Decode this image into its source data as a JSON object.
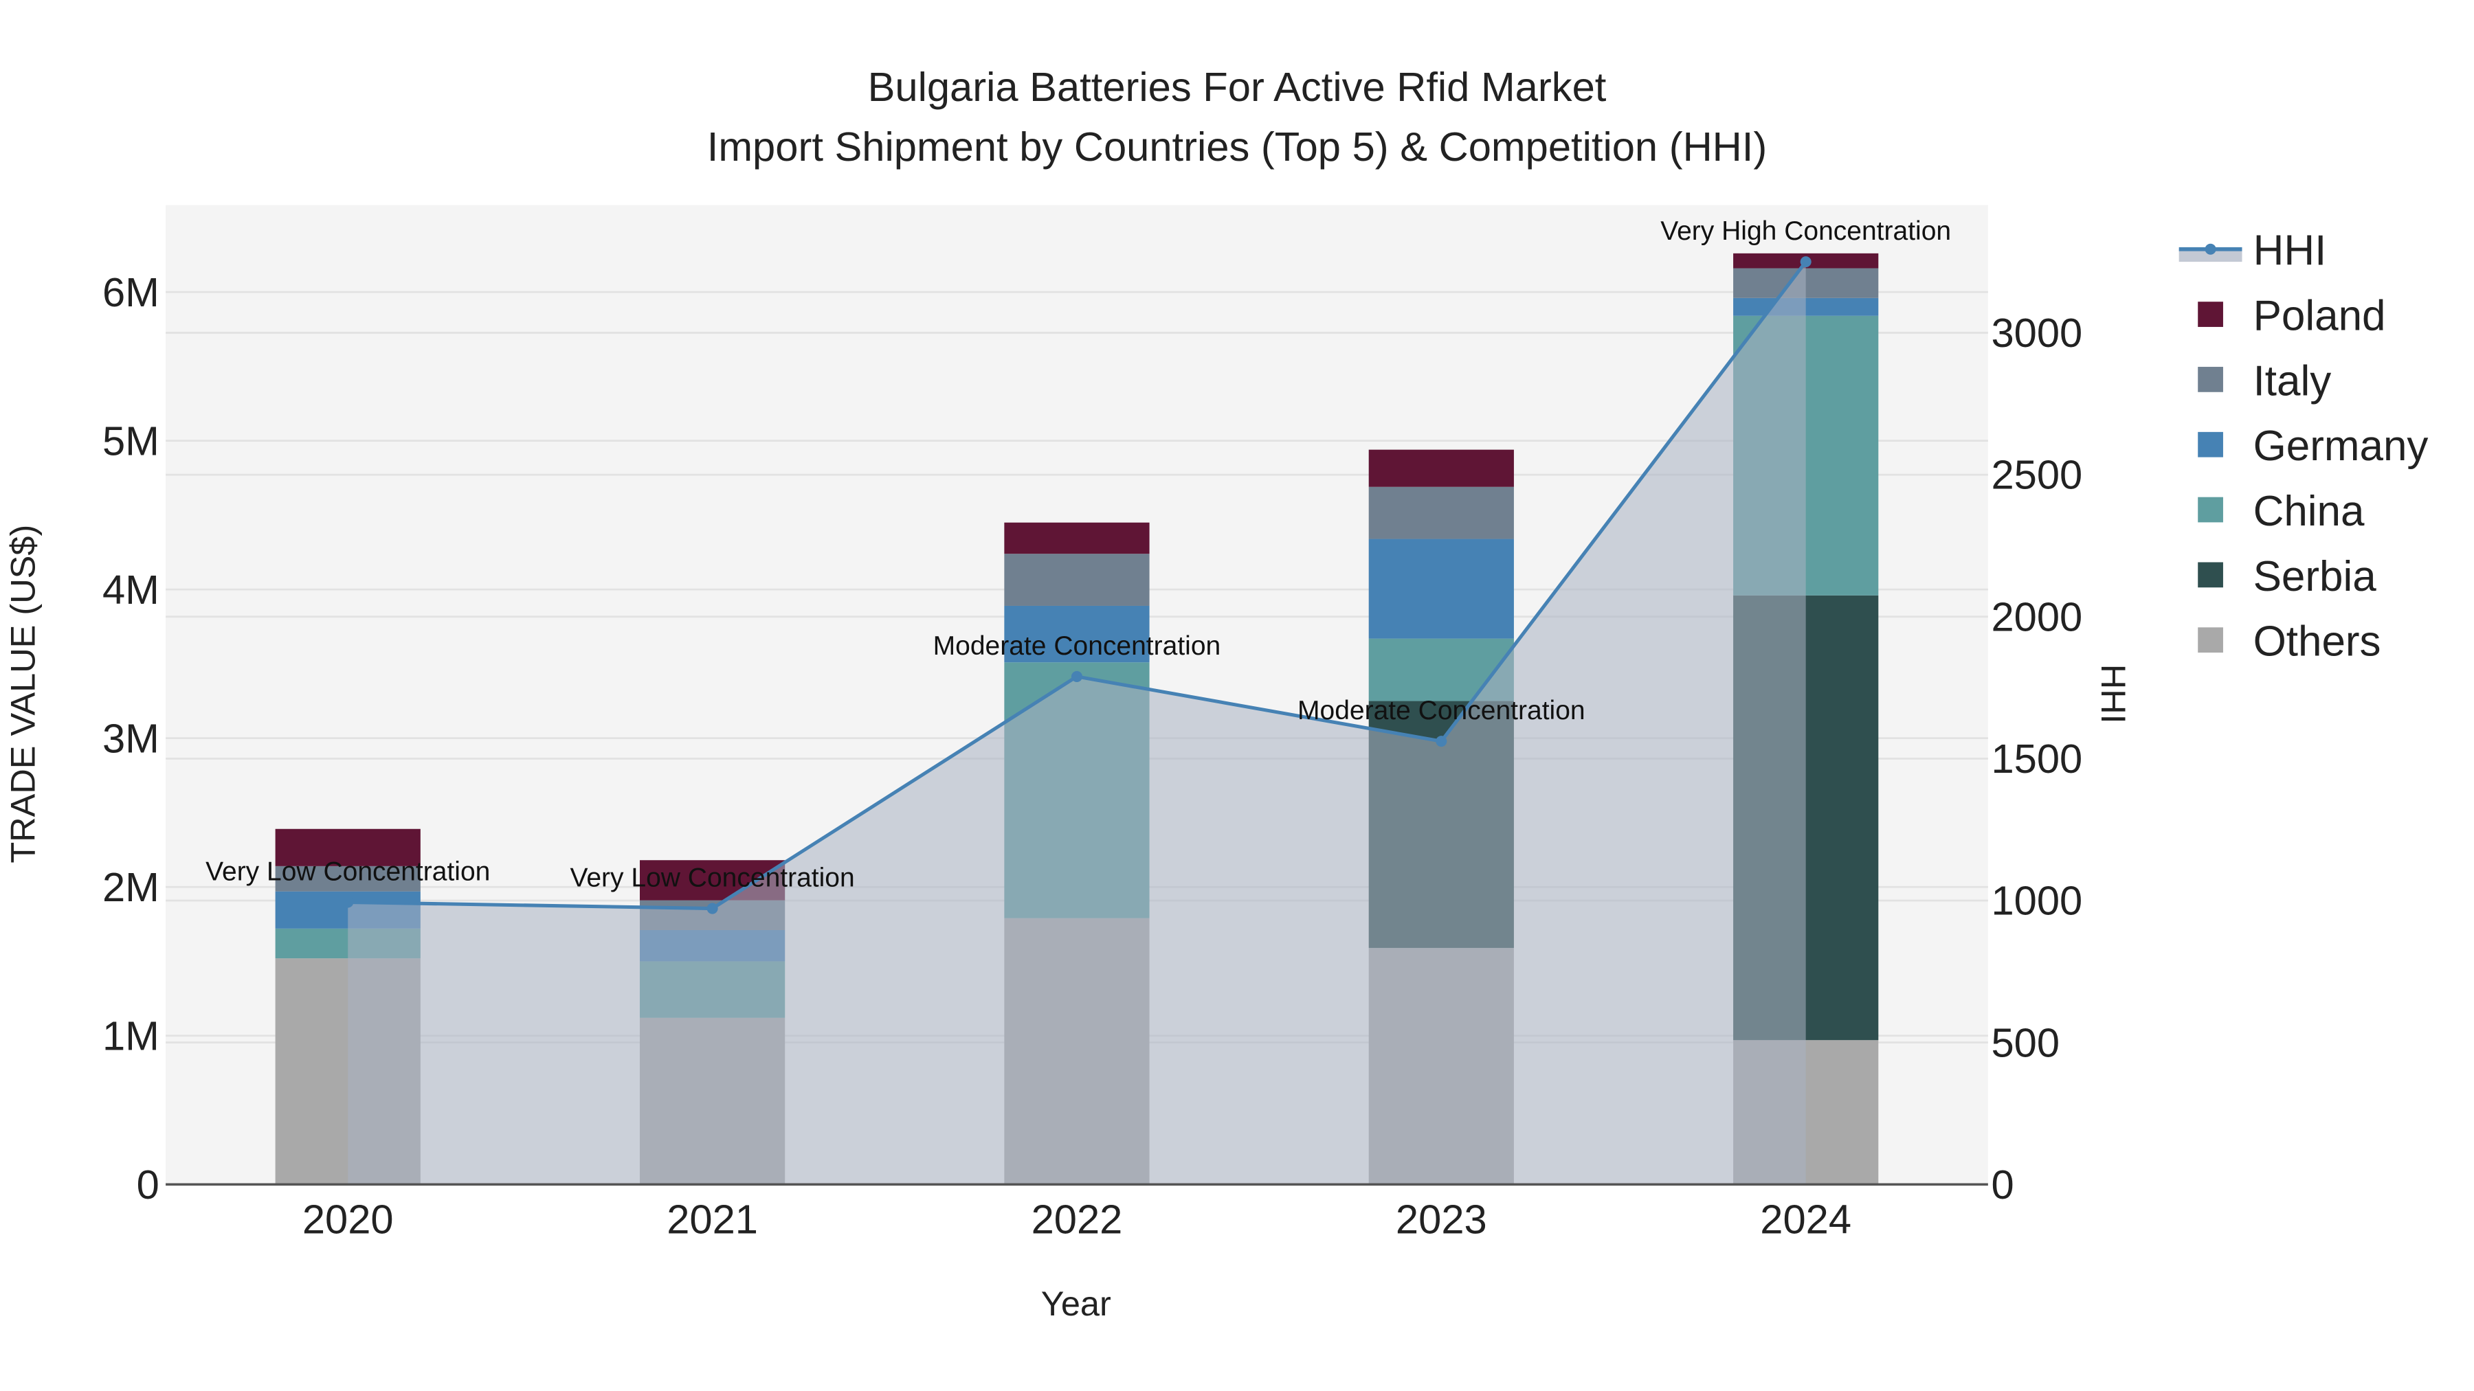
{
  "chart_data": {
    "type": "bar",
    "title": "Bulgaria Batteries For Active Rfid Market",
    "subtitle": "Import Shipment by Countries (Top 5) & Competition (HHI)",
    "xlabel": "Year",
    "ylabel": "TRADE VALUE (US$)",
    "y2label": "HHI",
    "categories": [
      "2020",
      "2021",
      "2022",
      "2023",
      "2024"
    ],
    "ylim": [
      0,
      6585000
    ],
    "y2lim": [
      0,
      3450
    ],
    "yticks": [
      0,
      1000000,
      2000000,
      3000000,
      4000000,
      5000000,
      6000000
    ],
    "ytick_labels": [
      "0",
      "1M",
      "2M",
      "3M",
      "4M",
      "5M",
      "6M"
    ],
    "y2ticks": [
      0,
      500,
      1000,
      1500,
      2000,
      2500,
      3000
    ],
    "y2tick_labels": [
      "0",
      "500",
      "1000",
      "1500",
      "2000",
      "2500",
      "3000"
    ],
    "series": [
      {
        "name": "Others",
        "color": "#a9a9a9",
        "values": [
          1520000,
          1120000,
          1790000,
          1590000,
          970000
        ]
      },
      {
        "name": "Serbia",
        "color": "#2f4f4f",
        "values": [
          0,
          0,
          0,
          1660000,
          2990000
        ]
      },
      {
        "name": "China",
        "color": "#5f9ea0",
        "values": [
          200000,
          380000,
          1720000,
          420000,
          1880000
        ]
      },
      {
        "name": "Germany",
        "color": "#4682b4",
        "values": [
          250000,
          210000,
          380000,
          670000,
          120000
        ]
      },
      {
        "name": "Italy",
        "color": "#708090",
        "values": [
          170000,
          200000,
          350000,
          350000,
          200000
        ]
      },
      {
        "name": "Poland",
        "color": "#5f1535",
        "values": [
          250000,
          270000,
          210000,
          250000,
          100000
        ]
      }
    ],
    "hhi": {
      "name": "HHI",
      "color": "#4682b4",
      "values": [
        994,
        972,
        1789,
        1561,
        3250
      ],
      "annotations": [
        "Very Low Concentration",
        "Very Low Concentration",
        "Moderate Concentration",
        "Moderate Concentration",
        "Very High Concentration"
      ]
    },
    "legend": [
      "HHI",
      "Poland",
      "Italy",
      "Germany",
      "China",
      "Serbia",
      "Others"
    ],
    "legend_placement": "right",
    "grid": true
  }
}
